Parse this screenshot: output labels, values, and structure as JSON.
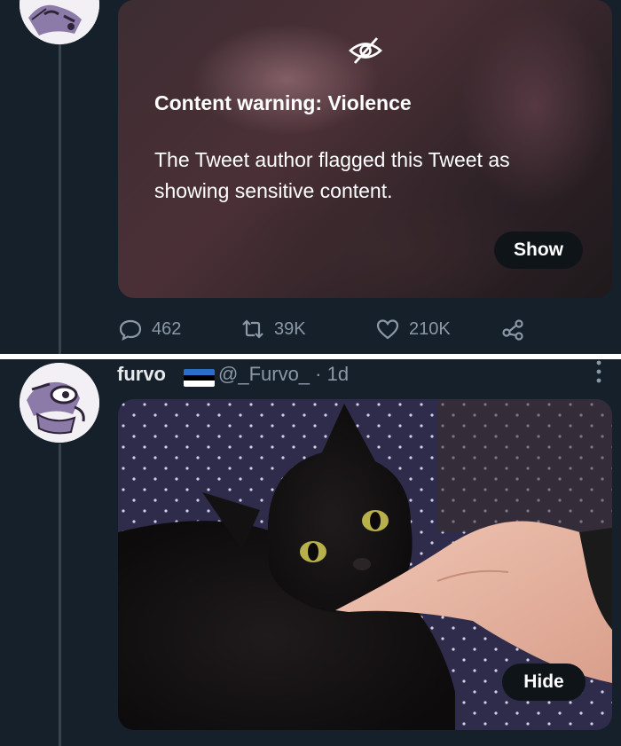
{
  "tweet_top": {
    "warning_title": "Content warning: Violence",
    "warning_body": "The Tweet author flagged this Tweet as showing sensitive content.",
    "show_button": "Show",
    "replies": "462",
    "retweets": "39K",
    "likes": "210K",
    "icons": [
      "eye-off-icon",
      "reply-icon",
      "retweet-icon",
      "like-icon",
      "share-icon"
    ]
  },
  "tweet_bottom": {
    "display_name": "furvo",
    "handle_time": "@_Furvo_ · 1d",
    "hide_button": "Hide",
    "flag_colors": [
      "#2a6ec9",
      "#000000",
      "#ffffff"
    ],
    "icons": [
      "more-icon",
      "avatar"
    ]
  },
  "colors": {
    "background": "#15202b",
    "secondary_text": "#8b98a5",
    "thread_line": "#38444d"
  }
}
